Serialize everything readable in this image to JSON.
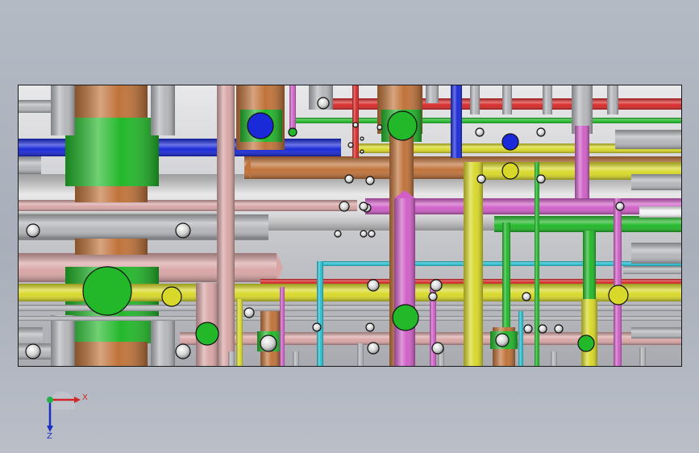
{
  "viewport": {
    "background": "#b0b6c0"
  },
  "triad": {
    "x_label": "X",
    "z_label": "Z",
    "x_color": "#d0282a",
    "z_color": "#1c2ec0",
    "y_color": "#22b04a"
  },
  "palette": {
    "brown": "#c0733a",
    "green": "#22b82a",
    "pink": "#d9a6a6",
    "gray": "#b4b6ba",
    "blue": "#1a2ad8",
    "red": "#d82a2a",
    "yellow": "#d8d82a",
    "magenta": "#d060c8",
    "cyan": "#2ac0d0",
    "white": "#f2f2f4"
  }
}
